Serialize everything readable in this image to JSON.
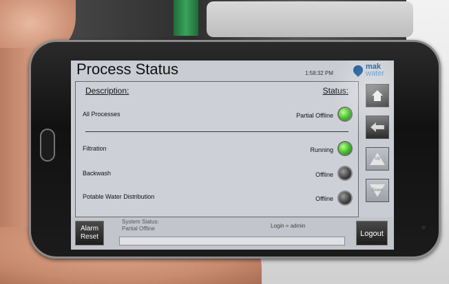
{
  "app": {
    "title": "Process Status",
    "clock": "1:58:32 PM",
    "logo": {
      "line1": "mak",
      "line2": "water"
    }
  },
  "table": {
    "description_header": "Description:",
    "status_header": "Status:",
    "rows": [
      {
        "label": "All Processes",
        "status": "Partial Offline",
        "lamp": "green"
      },
      {
        "label": "Filtration",
        "status": "Running",
        "lamp": "green"
      },
      {
        "label": "Backwash",
        "status": "Offline",
        "lamp": "grey"
      },
      {
        "label": "Potable Water Distribution",
        "status": "Offline",
        "lamp": "grey"
      }
    ]
  },
  "side_buttons": {
    "home_icon": "home-icon",
    "back_label": "Back",
    "up_label": "Up",
    "down_label": "Down"
  },
  "footer": {
    "alarm_reset_line1": "Alarm",
    "alarm_reset_line2": "Reset",
    "system_status_label": "System Status:",
    "system_status_value": "Partial Offline",
    "login_text": "Login = admin",
    "logout_label": "Logout"
  },
  "colors": {
    "lamp_green": "#3dbb25",
    "lamp_grey": "#3e3e3e",
    "logo_blue": "#0d4f8f",
    "screen_bg": "#c9ccd2"
  }
}
